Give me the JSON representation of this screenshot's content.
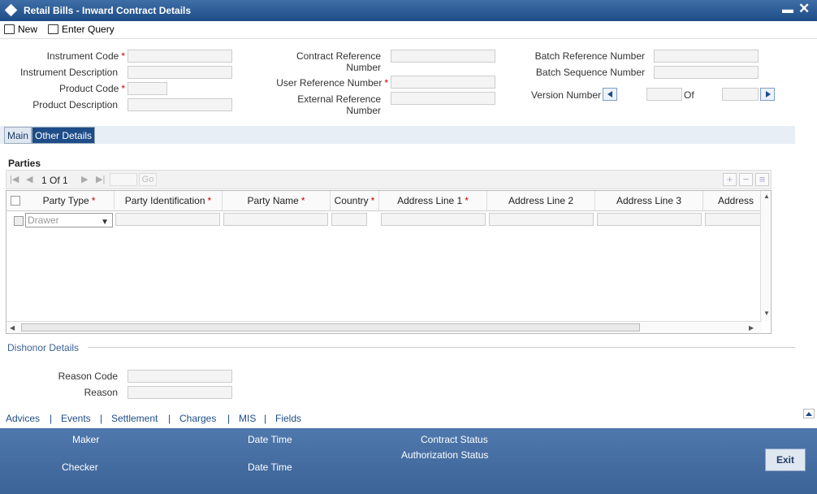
{
  "window": {
    "title": "Retail Bills - Inward Contract Details"
  },
  "toolbar": {
    "new_label": "New",
    "enter_query_label": "Enter Query"
  },
  "form": {
    "instrument_code_label": "Instrument Code",
    "instrument_description_label": "Instrument Description",
    "product_code_label": "Product Code",
    "product_description_label": "Product Description",
    "contract_reference_label_1": "Contract Reference",
    "contract_reference_label_2": "Number",
    "user_reference_label": "User Reference Number",
    "external_reference_label_1": "External Reference",
    "external_reference_label_2": "Number",
    "batch_reference_label": "Batch Reference Number",
    "batch_sequence_label": "Batch Sequence Number",
    "version_number_label": "Version Number",
    "version_of_label": "Of",
    "required_mark": "*"
  },
  "tabs": [
    {
      "label": "Main",
      "active": false
    },
    {
      "label": "Other Details",
      "active": true
    }
  ],
  "parties": {
    "section_title": "Parties",
    "pager_text": "1 Of 1",
    "go_label": "Go",
    "columns": [
      {
        "label": "Party Type",
        "required": true
      },
      {
        "label": "Party Identification",
        "required": true
      },
      {
        "label": "Party Name",
        "required": true
      },
      {
        "label": "Country",
        "required": true
      },
      {
        "label": "Address Line 1",
        "required": true
      },
      {
        "label": "Address Line 2",
        "required": false
      },
      {
        "label": "Address Line 3",
        "required": false
      },
      {
        "label": "Address",
        "required": false
      }
    ],
    "rows": [
      {
        "party_type": "Drawer"
      }
    ]
  },
  "dishonor": {
    "section_title": "Dishonor Details",
    "reason_code_label": "Reason Code",
    "reason_label": "Reason"
  },
  "footer_links": [
    "Advices",
    "Events",
    "Settlement",
    "Charges",
    "MIS",
    "Fields"
  ],
  "status_bar": {
    "maker_label": "Maker",
    "checker_label": "Checker",
    "date_time_label_1": "Date Time",
    "date_time_label_2": "Date Time",
    "contract_status_label": "Contract Status",
    "authorization_status_label": "Authorization Status",
    "exit_label": "Exit"
  },
  "colors": {
    "title_bar": "#1d4c87",
    "required": "#cc0000",
    "bottom_bar": "#4a72a8",
    "link": "#1d4c87"
  }
}
